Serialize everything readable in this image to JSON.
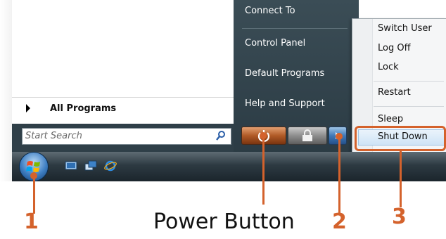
{
  "start_menu": {
    "all_programs_label": "All Programs",
    "search_placeholder": "Start Search",
    "right_items": [
      "Connect To",
      "Control Panel",
      "Default Programs",
      "Help and Support"
    ]
  },
  "submenu": {
    "items": [
      "Switch User",
      "Log Off",
      "Lock",
      "Restart",
      "Sleep",
      "Shut Down"
    ],
    "highlighted": "Shut Down"
  },
  "callouts": {
    "label_1": "1",
    "label_2": "2",
    "label_3": "3",
    "power_button_caption": "Power Button"
  },
  "colors": {
    "callout": "#d4622c",
    "taskbar": "#2d3a42",
    "menu_right_pane": "#34454e"
  }
}
